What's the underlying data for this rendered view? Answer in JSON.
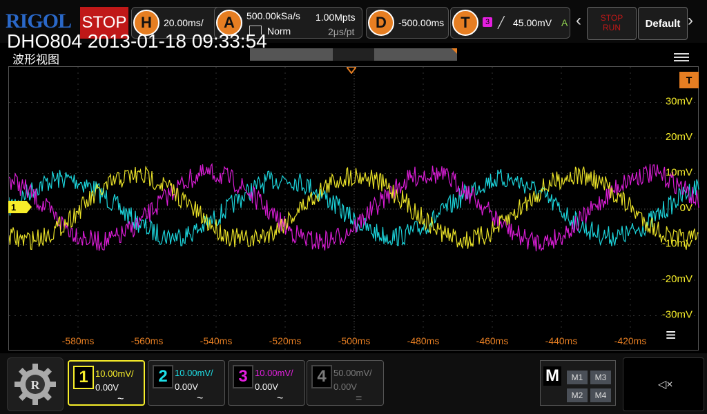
{
  "brand": "RIGOL",
  "run_state": "STOP",
  "overlay_text": "DHO804 2013-01-18 09:33:54",
  "panel_title": "波形视图",
  "horizontal": {
    "key": "H",
    "value": "20.00ms/"
  },
  "acquire": {
    "key": "A",
    "rate": "500.00kSa/s",
    "mode": "Norm",
    "depth": "1.00Mpts",
    "interval": "2μs/pt"
  },
  "delay": {
    "key": "D",
    "value": "-500.00ms"
  },
  "trigger": {
    "key": "T",
    "source": "3",
    "level": "45.00mV",
    "mode": "A"
  },
  "run_stop_button": {
    "line1": "STOP",
    "line2": "RUN"
  },
  "default_button": "Default",
  "y_ticks": [
    "30mV",
    "20mV",
    "10mV",
    "0V",
    "-10mV",
    "-20mV",
    "-30mV"
  ],
  "x_ticks": [
    "-580ms",
    "-560ms",
    "-540ms",
    "-520ms",
    "-500ms",
    "-480ms",
    "-460ms",
    "-440ms",
    "-420ms"
  ],
  "ch1_marker": "1",
  "trig_marker": "T",
  "channels": [
    {
      "num": "1",
      "scale": "10.00mV/",
      "offset": "0.00V",
      "coupling": "~",
      "color": "#f7ee2a",
      "active": true
    },
    {
      "num": "2",
      "scale": "10.00mV/",
      "offset": "0.00V",
      "coupling": "~",
      "color": "#1ee0e8",
      "active": false
    },
    {
      "num": "3",
      "scale": "10.00mV/",
      "offset": "0.00V",
      "coupling": "~",
      "color": "#e51fe0",
      "active": false
    },
    {
      "num": "4",
      "scale": "50.00mV/",
      "offset": "0.00V",
      "coupling": "=",
      "color": "#7a7a7a",
      "active": false
    }
  ],
  "math": {
    "label": "M",
    "items": [
      "M1",
      "M3",
      "M2",
      "M4"
    ]
  },
  "colors": {
    "ch1": "#f7ee2a",
    "ch2": "#1ee0e8",
    "ch3": "#e51fe0",
    "accent": "#e67e22"
  }
}
